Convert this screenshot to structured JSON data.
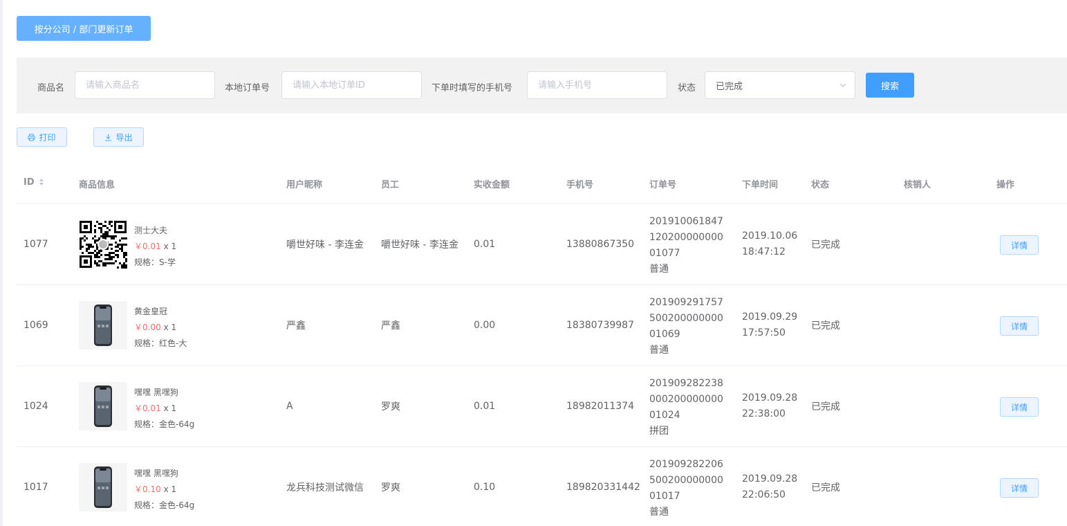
{
  "top_button": {
    "label": "按分公司 / 部门更新订单"
  },
  "filters": {
    "product_label": "商品名",
    "product_placeholder": "请输入商品名",
    "order_label": "本地订单号",
    "order_placeholder": "请输入本地订单ID",
    "phone_label": "下单时填写的手机号",
    "phone_placeholder": "请输入手机号",
    "status_label": "状态",
    "status_value": "已完成",
    "search_label": "搜索"
  },
  "toolbar": {
    "print_label": "打印",
    "export_label": "导出"
  },
  "colors": {
    "primary": "#409eff",
    "light_primary": "#66b1ff",
    "price": "#f56c6c",
    "filter_bg": "#f2f2f2"
  },
  "table": {
    "headers": {
      "id": "ID",
      "product": "商品信息",
      "nickname": "用户昵称",
      "staff": "员工",
      "amount": "实收金额",
      "phone": "手机号",
      "order_no": "订单号",
      "time": "下单时间",
      "status": "状态",
      "verifier": "核销人",
      "action": "操作"
    },
    "rows": [
      {
        "id": "1077",
        "thumb_icon": "qr-code-icon",
        "name": "测士大夫",
        "price": "￥0.01",
        "qty": "x 1",
        "spec": "规格：S-学",
        "nickname": "嚼世好味 - 李连金",
        "staff": "嚼世好味 - 李连金",
        "amount": "0.01",
        "phone": "13880867350",
        "order_no": "20191006184712020000000001077",
        "order_type": "普通",
        "date": "2019.10.06",
        "clock": "18:47:12",
        "status": "已完成",
        "verifier": "",
        "action": "详情"
      },
      {
        "id": "1069",
        "thumb_icon": "phone-image-icon",
        "name": "黄金皇冠",
        "price": "￥0.00",
        "qty": "x 1",
        "spec": "规格：红色-大",
        "nickname": "严鑫",
        "staff": "严鑫",
        "amount": "0.00",
        "phone": "18380739987",
        "order_no": "20190929175750020000000001069",
        "order_type": "普通",
        "date": "2019.09.29",
        "clock": "17:57:50",
        "status": "已完成",
        "verifier": "",
        "action": "详情"
      },
      {
        "id": "1024",
        "thumb_icon": "phone-image-icon",
        "name": "嘿嘿 黑嘿狗",
        "price": "￥0.01",
        "qty": "x 1",
        "spec": "规格：金色-64g",
        "nickname": "A",
        "staff": "罗爽",
        "amount": "0.01",
        "phone": "18982011374",
        "order_no": "20190928223800020000000001024",
        "order_type": "拼团",
        "date": "2019.09.28",
        "clock": "22:38:00",
        "status": "已完成",
        "verifier": "",
        "action": "详情"
      },
      {
        "id": "1017",
        "thumb_icon": "phone-image-icon",
        "name": "嘿嘿 黑嘿狗",
        "price": "￥0.10",
        "qty": "x 1",
        "spec": "规格：金色-64g",
        "nickname": "龙兵科技测试微信",
        "staff": "罗爽",
        "amount": "0.10",
        "phone": "189820331442",
        "order_no": "20190928220650020000000001017",
        "order_type": "普通",
        "date": "2019.09.28",
        "clock": "22:06:50",
        "status": "已完成",
        "verifier": "",
        "action": "详情"
      }
    ]
  }
}
